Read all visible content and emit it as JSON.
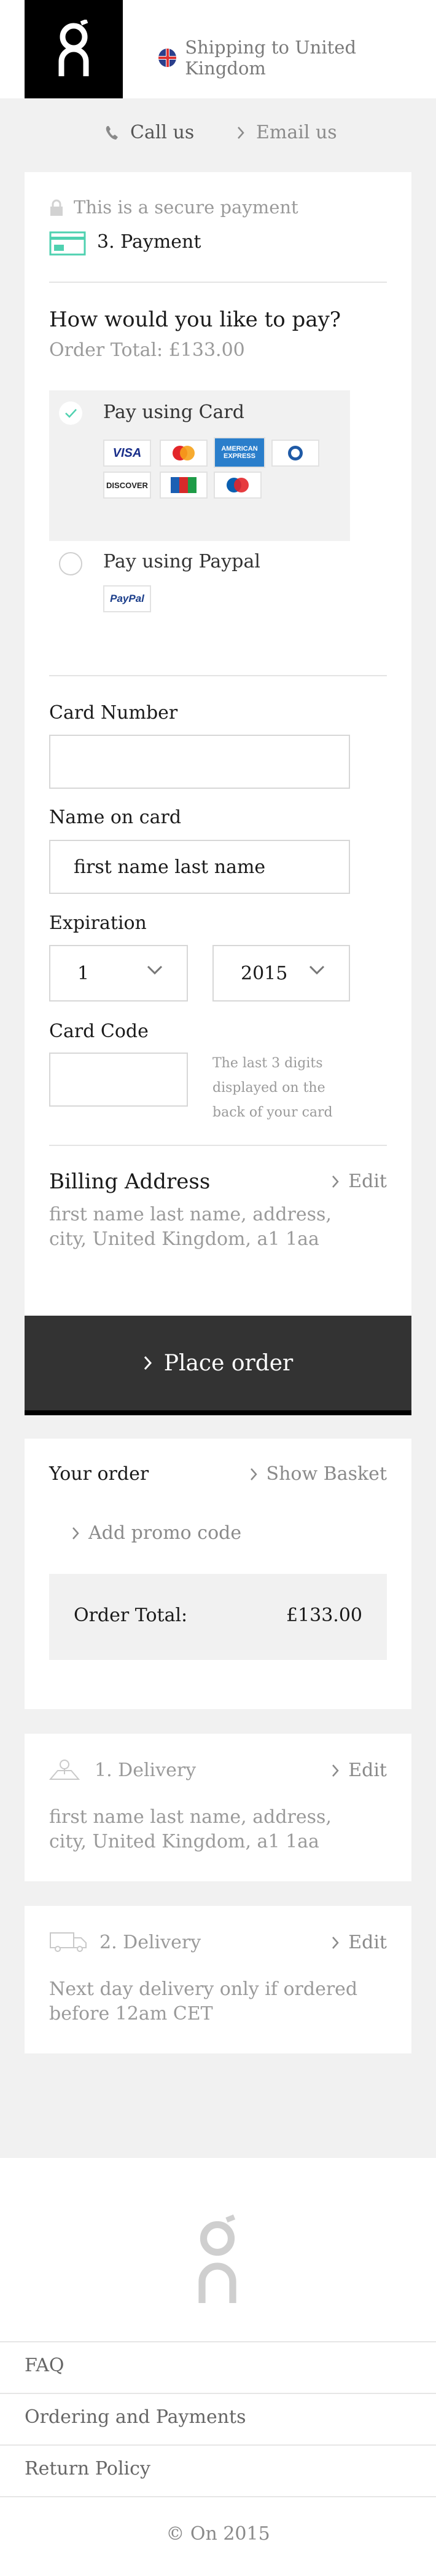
{
  "header": {
    "shipping_text": "Shipping to United Kingdom"
  },
  "contact": {
    "call_label": "Call us",
    "email_label": "Email us"
  },
  "payment": {
    "secure_text": "This is a secure payment",
    "step_title": "3. Payment",
    "question": "How would you like to pay?",
    "order_total_line": "Order Total: £133.00",
    "option_card_label": "Pay using Card",
    "option_paypal_label": "Pay using Paypal",
    "card_logos": [
      "VISA",
      "MasterCard",
      "AMERICAN EXPRESS",
      "Diners",
      "DISCOVER",
      "JCB",
      "Maestro"
    ],
    "paypal_logo": "PayPal",
    "card_number_label": "Card Number",
    "card_number_value": "",
    "name_label": "Name on card",
    "name_value": "first name last name",
    "expiration_label": "Expiration",
    "exp_month": "1",
    "exp_year": "2015",
    "card_code_label": "Card Code",
    "card_code_value": "",
    "card_code_hint": "The last 3 digits displayed on the back of your card",
    "billing_title": "Billing Address",
    "billing_edit": "Edit",
    "billing_address": "first name last name, address, city, United Kingdom, a1 1aa"
  },
  "place_order_label": "Place order",
  "order": {
    "title": "Your order",
    "show_basket": "Show Basket",
    "promo_label": "Add promo code",
    "total_label": "Order Total:",
    "total_value": "£133.00"
  },
  "delivery_address": {
    "title": "1. Delivery",
    "edit": "Edit",
    "text": "first name last name, address, city, United Kingdom, a1 1aa"
  },
  "delivery_method": {
    "title": "2. Delivery",
    "edit": "Edit",
    "text": "Next day delivery only if ordered before 12am CET"
  },
  "footer": {
    "links": [
      "FAQ",
      "Ordering and Payments",
      "Return Policy"
    ],
    "copyright": "© On 2015"
  },
  "colors": {
    "accent": "#4fd1b0",
    "button_bg": "#333333"
  }
}
